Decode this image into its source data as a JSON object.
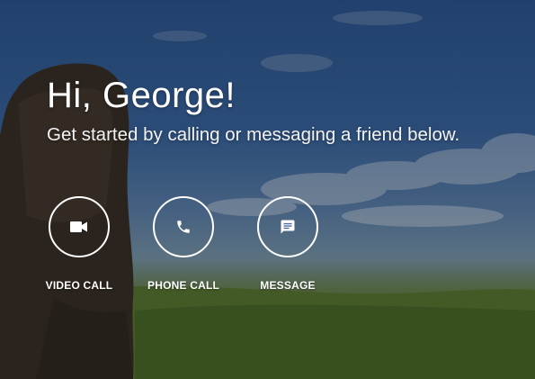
{
  "greeting": "Hi, George!",
  "subtitle": "Get started by calling or messaging a friend below.",
  "actions": [
    {
      "label": "VIDEO CALL",
      "icon": "video-camera-icon"
    },
    {
      "label": "PHONE CALL",
      "icon": "phone-icon"
    },
    {
      "label": "MESSAGE",
      "icon": "message-bubble-icon"
    }
  ],
  "colors": {
    "sky": "#3c6aa6",
    "grass": "#5b7a32",
    "text": "#ffffff"
  }
}
